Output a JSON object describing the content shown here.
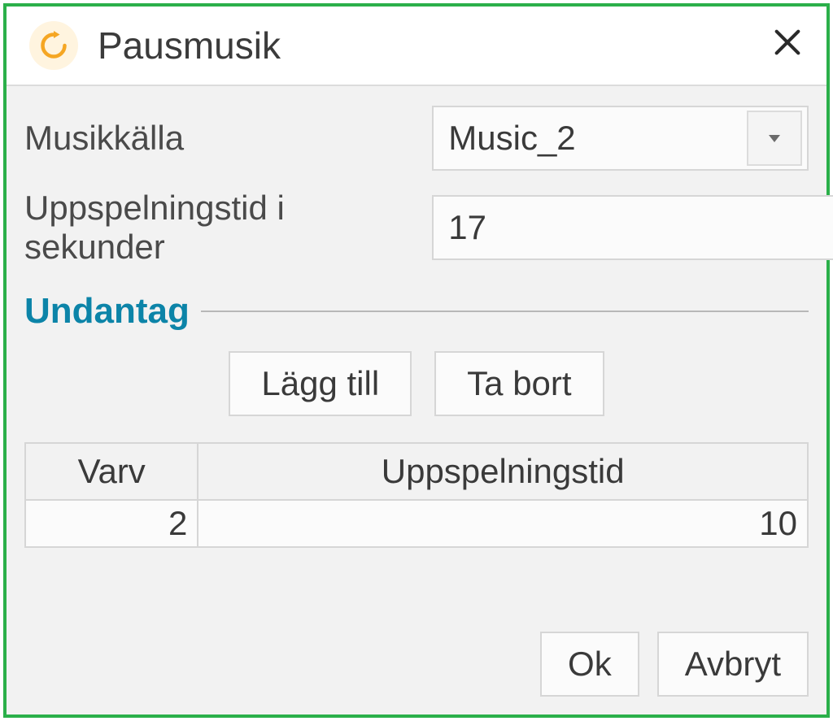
{
  "title": "Pausmusik",
  "form": {
    "musicSourceLabel": "Musikkälla",
    "musicSourceValue": "Music_2",
    "playbackTimeLabel": "Uppspelningstid i sekunder",
    "playbackTimeValue": "17"
  },
  "exceptions": {
    "legend": "Undantag",
    "addLabel": "Lägg till",
    "removeLabel": "Ta bort",
    "colVarv": "Varv",
    "colTime": "Uppspelningstid",
    "rows": [
      {
        "varv": "2",
        "time": "10"
      }
    ]
  },
  "footer": {
    "ok": "Ok",
    "cancel": "Avbryt"
  }
}
